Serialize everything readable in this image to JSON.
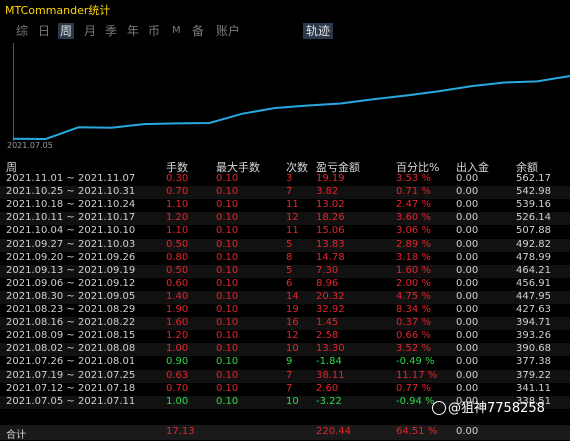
{
  "app": {
    "title": "MTCommander统计"
  },
  "tabs": [
    {
      "label": "综",
      "active": false
    },
    {
      "label": "日",
      "active": false
    },
    {
      "label": "周",
      "active": true
    },
    {
      "label": "月",
      "active": false
    },
    {
      "label": "季",
      "active": false
    },
    {
      "label": "年",
      "active": false
    },
    {
      "label": "币",
      "active": false
    },
    {
      "label": "M",
      "active": false
    },
    {
      "label": "备",
      "active": false
    },
    {
      "label": "账户",
      "active": false
    },
    {
      "label": "轨迹",
      "active": false
    }
  ],
  "chart_data": {
    "type": "line",
    "x_start_label": "2021.07.05",
    "x": [
      "2021.07.05",
      "2021.07.12",
      "2021.07.19",
      "2021.07.26",
      "2021.08.02",
      "2021.08.09",
      "2021.08.16",
      "2021.08.23",
      "2021.08.30",
      "2021.09.06",
      "2021.09.13",
      "2021.09.20",
      "2021.09.27",
      "2021.10.04",
      "2021.10.11",
      "2021.10.18",
      "2021.10.25",
      "2021.11.01"
    ],
    "values": [
      338.51,
      337.59,
      379.22,
      377.38,
      390.68,
      393.26,
      394.71,
      427.63,
      447.95,
      456.91,
      464.21,
      478.99,
      492.82,
      507.88,
      526.14,
      539.16,
      542.98,
      562.17
    ],
    "color": "#29a8e0",
    "grid": false
  },
  "table": {
    "headers": [
      "周",
      "手数",
      "最大手数",
      "次数",
      "盈亏金额",
      "百分比%",
      "出入金",
      "余额"
    ],
    "rows": [
      {
        "week": "2021.11.01 ~ 2021.11.07",
        "lots": "0.30",
        "max": "0.10",
        "count": "3",
        "pnl": "19.19",
        "pct": "3.53 %",
        "io": "0.00",
        "bal": "562.17",
        "color": "red"
      },
      {
        "week": "2021.10.25 ~ 2021.10.31",
        "lots": "0.70",
        "max": "0.10",
        "count": "7",
        "pnl": "3.82",
        "pct": "0.71 %",
        "io": "0.00",
        "bal": "542.98",
        "color": "red"
      },
      {
        "week": "2021.10.18 ~ 2021.10.24",
        "lots": "1.10",
        "max": "0.10",
        "count": "11",
        "pnl": "13.02",
        "pct": "2.47 %",
        "io": "0.00",
        "bal": "539.16",
        "color": "red"
      },
      {
        "week": "2021.10.11 ~ 2021.10.17",
        "lots": "1.20",
        "max": "0.10",
        "count": "12",
        "pnl": "18.26",
        "pct": "3.60 %",
        "io": "0.00",
        "bal": "526.14",
        "color": "red"
      },
      {
        "week": "2021.10.04 ~ 2021.10.10",
        "lots": "1.10",
        "max": "0.10",
        "count": "11",
        "pnl": "15.06",
        "pct": "3.06 %",
        "io": "0.00",
        "bal": "507.88",
        "color": "red"
      },
      {
        "week": "2021.09.27 ~ 2021.10.03",
        "lots": "0.50",
        "max": "0.10",
        "count": "5",
        "pnl": "13.83",
        "pct": "2.89 %",
        "io": "0.00",
        "bal": "492.82",
        "color": "red"
      },
      {
        "week": "2021.09.20 ~ 2021.09.26",
        "lots": "0.80",
        "max": "0.10",
        "count": "8",
        "pnl": "14.78",
        "pct": "3.18 %",
        "io": "0.00",
        "bal": "478.99",
        "color": "red"
      },
      {
        "week": "2021.09.13 ~ 2021.09.19",
        "lots": "0.50",
        "max": "0.10",
        "count": "5",
        "pnl": "7.30",
        "pct": "1.60 %",
        "io": "0.00",
        "bal": "464.21",
        "color": "red"
      },
      {
        "week": "2021.09.06 ~ 2021.09.12",
        "lots": "0.60",
        "max": "0.10",
        "count": "6",
        "pnl": "8.96",
        "pct": "2.00 %",
        "io": "0.00",
        "bal": "456.91",
        "color": "red"
      },
      {
        "week": "2021.08.30 ~ 2021.09.05",
        "lots": "1.40",
        "max": "0.10",
        "count": "14",
        "pnl": "20.32",
        "pct": "4.75 %",
        "io": "0.00",
        "bal": "447.95",
        "color": "red"
      },
      {
        "week": "2021.08.23 ~ 2021.08.29",
        "lots": "1.90",
        "max": "0.10",
        "count": "19",
        "pnl": "32.92",
        "pct": "8.34 %",
        "io": "0.00",
        "bal": "427.63",
        "color": "red"
      },
      {
        "week": "2021.08.16 ~ 2021.08.22",
        "lots": "1.60",
        "max": "0.10",
        "count": "16",
        "pnl": "1.45",
        "pct": "0.37 %",
        "io": "0.00",
        "bal": "394.71",
        "color": "red"
      },
      {
        "week": "2021.08.09 ~ 2021.08.15",
        "lots": "1.20",
        "max": "0.10",
        "count": "12",
        "pnl": "2.58",
        "pct": "0.66 %",
        "io": "0.00",
        "bal": "393.26",
        "color": "red"
      },
      {
        "week": "2021.08.02 ~ 2021.08.08",
        "lots": "1.00",
        "max": "0.10",
        "count": "10",
        "pnl": "13.30",
        "pct": "3.52 %",
        "io": "0.00",
        "bal": "390.68",
        "color": "red"
      },
      {
        "week": "2021.07.26 ~ 2021.08.01",
        "lots": "0.90",
        "max": "0.10",
        "count": "9",
        "pnl": "-1.84",
        "pct": "-0.49 %",
        "io": "0.00",
        "bal": "377.38",
        "color": "green"
      },
      {
        "week": "2021.07.19 ~ 2021.07.25",
        "lots": "0.63",
        "max": "0.10",
        "count": "7",
        "pnl": "38.11",
        "pct": "11.17 %",
        "io": "0.00",
        "bal": "379.22",
        "color": "red"
      },
      {
        "week": "2021.07.12 ~ 2021.07.18",
        "lots": "0.70",
        "max": "0.10",
        "count": "7",
        "pnl": "2.60",
        "pct": "0.77 %",
        "io": "0.00",
        "bal": "341.11",
        "color": "red"
      },
      {
        "week": "2021.07.05 ~ 2021.07.11",
        "lots": "1.00",
        "max": "0.10",
        "count": "10",
        "pnl": "-3.22",
        "pct": "-0.94 %",
        "io": "0.00",
        "bal": "338.51",
        "color": "green"
      }
    ],
    "total": {
      "label": "合计",
      "lots": "17.13",
      "pnl": "220.44",
      "pct": "64.51 %",
      "io": "0.00"
    }
  },
  "watermark": "@狙神7758258"
}
